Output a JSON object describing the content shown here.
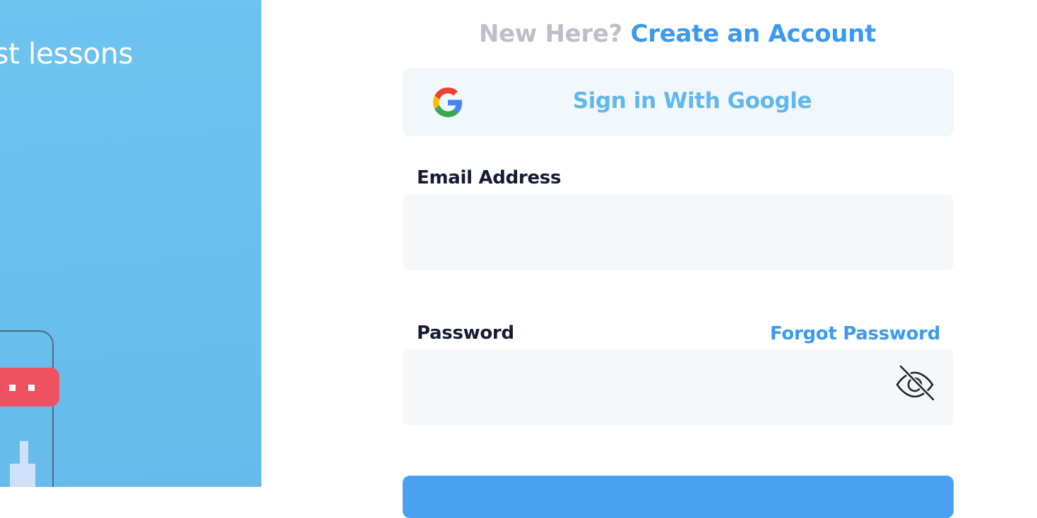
{
  "hero": {
    "headline": "st lessons"
  },
  "signup": {
    "prompt": "New Here?",
    "link": "Create an Account"
  },
  "google": {
    "label": "Sign in With Google",
    "icon": "google-icon"
  },
  "email": {
    "label": "Email Address",
    "value": "",
    "placeholder": ""
  },
  "password": {
    "label": "Password",
    "value": "",
    "placeholder": "",
    "forgot_label": "Forgot Password",
    "toggle_icon": "eye-off-icon"
  },
  "colors": {
    "hero_bg": "#6ac0ee",
    "accent": "#3b99f0",
    "google_text": "#61b6ec",
    "label_text": "#161b33",
    "muted_text": "#bdbdcb",
    "input_bg": "#f5f7f9",
    "bubble": "#ee5260"
  }
}
